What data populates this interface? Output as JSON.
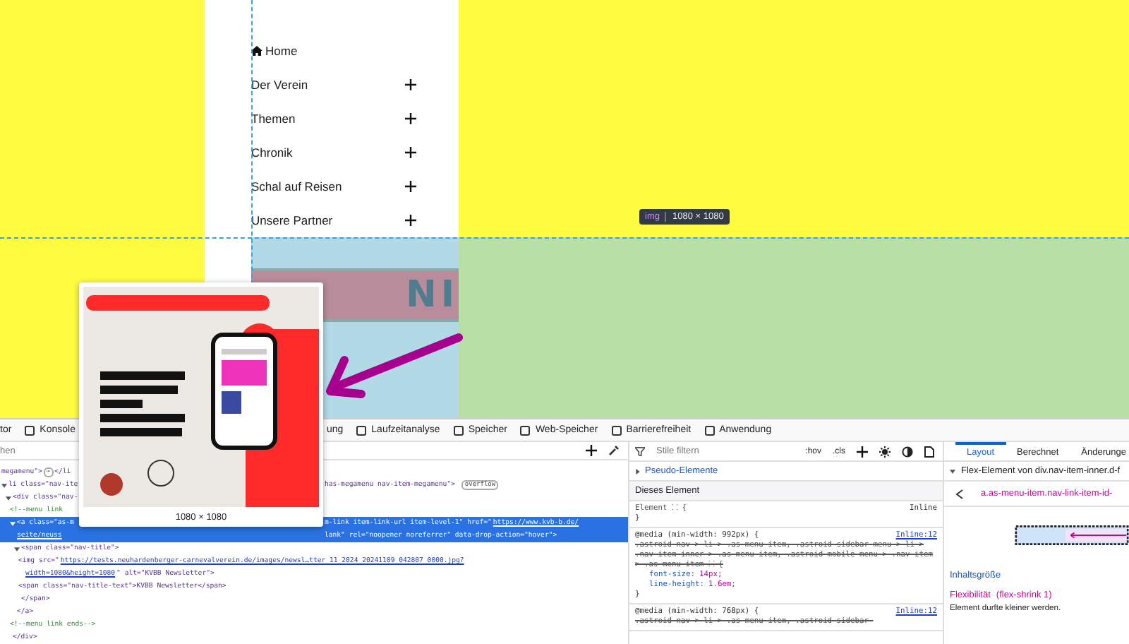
{
  "page": {
    "menu": [
      {
        "kind": "home",
        "label": "Home"
      },
      {
        "kind": "submenu",
        "label": "Der Verein"
      },
      {
        "kind": "submenu",
        "label": "Themen"
      },
      {
        "kind": "submenu",
        "label": "Chronik"
      },
      {
        "kind": "submenu",
        "label": "Schal auf Reisen"
      },
      {
        "kind": "submenu",
        "label": "Unsere Partner"
      }
    ],
    "banner_text": "NI",
    "tooltip": {
      "tag": "img",
      "size": "1080 × 1080"
    },
    "image_preview": {
      "caption": "1080 × 1080"
    }
  },
  "devtools": {
    "tabs": [
      {
        "label": "tor"
      },
      {
        "label": "Konsole"
      },
      {
        "label": "ung"
      },
      {
        "label": "Laufzeitanalyse"
      },
      {
        "label": "Speicher"
      },
      {
        "label": "Web-Speicher"
      },
      {
        "label": "Barrierefreiheit"
      },
      {
        "label": "Anwendung"
      }
    ],
    "html_panel": {
      "search_placeholder": "hen",
      "nodes": [
        {
          "left": "megamenu\">",
          "badge_left": "⋯",
          "left_after": "</li",
          "selected": false
        },
        {
          "left": "li class=\"nav-ite",
          "right": "has-megamenu nav-item-megamenu\">",
          "badge": "overflow",
          "selected": false,
          "expanded": true,
          "children": [
            {
              "left": "<div class=\"nav-",
              "selected": false,
              "expanded": true,
              "closing": "</div>",
              "children": [
                {
                  "left": "<!--menu link",
                  "comment": true,
                  "selected": false
                },
                {
                  "left": "<a class=\"as-m",
                  "right": "m-link item-link-url item-level-1\" href=\"",
                  "link": "https://www.kvb-b.de/",
                  "left_2": "seite/neuss",
                  "right_2": "lank\" rel=\"noopener noreferrer\" data-drop-action=\"hover\">",
                  "selected": true,
                  "expanded": true,
                  "closing": "</a>",
                  "children": [
                    {
                      "text": "<span class=\"nav-title\">",
                      "selected": false,
                      "expanded": true,
                      "closing": "</span>",
                      "children": [
                        {
                          "text": "<img src=\"",
                          "link": "https://tests.neuhardenberger-carnevalverein.de/images/newsl…tter_11_2024_20241109_042807_0000.jpg?",
                          "link_2": "width=1080&height=1080",
                          "text_after": "\" alt=\"KVBB Newsletter\">",
                          "selected": false
                        },
                        {
                          "text": "<span class=\"nav-title-text\">KVBB Newsletter</span>",
                          "selected": false
                        }
                      ]
                    }
                  ]
                },
                {
                  "text": "<!--menu link ends-->",
                  "comment": true,
                  "selected": false
                }
              ]
            }
          ]
        }
      ]
    },
    "styles_panel": {
      "filter_placeholder": "Stile filtern",
      "toggles": [
        ":hov",
        ".cls"
      ],
      "pseudo": {
        "label": "Pseudo-Elemente",
        "expanded": false
      },
      "heading": "Dieses Element",
      "rules": [
        {
          "selector": "Element ⸬ {",
          "source": "Inline",
          "overridden": false,
          "close": "}"
        },
        {
          "media": "@media (min-width: 992px) {",
          "source": "Inline:12",
          "selector": ".astroid-nav > li > .as-menu-item, .astroid-sidebar-menu > li > .nav-item-inner > .as-menu-item, .astroid-mobile-menu > .nav-item > .as-menu-item ⸬ {",
          "overridden": true,
          "declarations": [
            {
              "property": "font-size:",
              "value": "14px;"
            },
            {
              "property": "line-height:",
              "value": "1.6em;"
            }
          ],
          "close": "}"
        },
        {
          "media": "@media (min-width: 768px) {",
          "source": "Inline:12",
          "selector": ".astroid-nav > li > .as-menu-item, .astroid-sidebar-",
          "overridden": true
        }
      ]
    },
    "layout_panel": {
      "tabs": [
        {
          "label": "Layout",
          "selected": true
        },
        {
          "label": "Berechnet",
          "selected": false
        },
        {
          "label": "Änderunge",
          "selected": false
        }
      ],
      "flex_header": {
        "label": "Flex-Element von div.nav-item-inner.d-f",
        "expanded": true
      },
      "element_link": "a.as-menu-item.nav-link-item-id-",
      "content_size": "Inhaltsgröße",
      "flex_label": "Flexibilität",
      "flex_value": "(flex-shrink 1)",
      "flex_note": "Element durfte kleiner werden."
    }
  }
}
